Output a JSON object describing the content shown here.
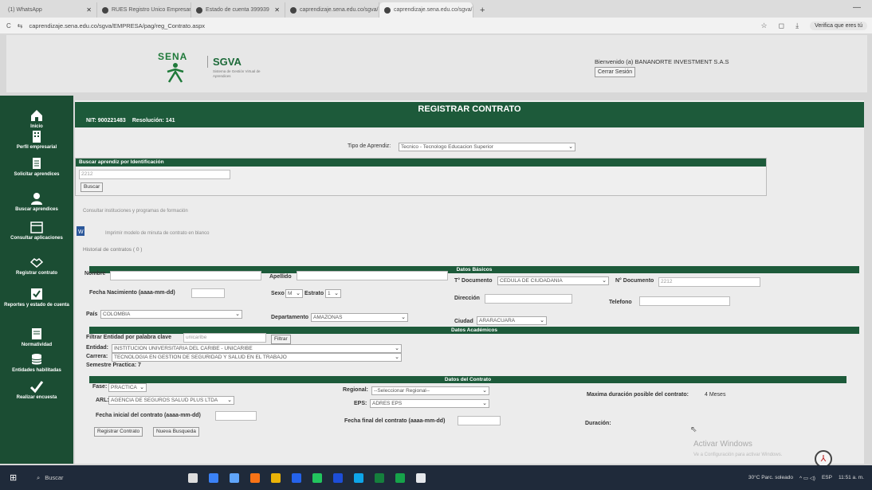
{
  "browser": {
    "tabs": [
      {
        "label": "(1) WhatsApp"
      },
      {
        "label": "RUES Registro Unico Empresar"
      },
      {
        "label": "Estado de cuenta 399939"
      },
      {
        "label": "caprendizaje.sena.edu.co/sgva/"
      },
      {
        "label": "caprendizaje.sena.edu.co/sgva/"
      }
    ],
    "new_tab": "+",
    "url": "caprendizaje.sena.edu.co/sgva/EMPRESA/pag/reg_Contrato.aspx",
    "verify_label": "Verifica que eres tú"
  },
  "header": {
    "sena_logo_text": "SENA",
    "sgva_title": "SGVA",
    "sgva_subtitle": "Sistema de Gestión Virtual de Aprendices",
    "welcome": "Bienvenido (a) BANANORTE INVESTMENT S.A.S",
    "logout_label": "Cerrar Sesión"
  },
  "sidebar": {
    "items": [
      {
        "label": "Inicio",
        "icon": "home-icon"
      },
      {
        "label": "Perfil empresarial",
        "icon": "building-icon"
      },
      {
        "label": "Solicitar aprendices",
        "icon": "document-icon"
      },
      {
        "label": "Buscar aprendices",
        "icon": "user-icon"
      },
      {
        "label": "Consultar aplicaciones",
        "icon": "calendar-icon"
      },
      {
        "label": "Registrar contrato",
        "icon": "handshake-icon"
      },
      {
        "label": "Reportes y estado de cuenta",
        "icon": "check-box-icon"
      },
      {
        "label": "Normatividad",
        "icon": "book-icon"
      },
      {
        "label": "Entidades habilitadas",
        "icon": "database-icon"
      },
      {
        "label": "Realizar encuesta",
        "icon": "checkmark-icon"
      }
    ]
  },
  "page": {
    "title": "REGISTRAR CONTRATO",
    "nit": "NIT: 900221483",
    "resolucion": "Resolución: 141",
    "tipo_aprendiz_label": "Tipo de Aprendiz:",
    "tipo_aprendiz_value": "Tecnico - Tecnologo Educacion Superior",
    "buscar_panel_title": "Buscar aprendiz por Identificación",
    "buscar_input_value": "2212",
    "buscar_button": "Buscar",
    "consultar_link": "Consultar instituciones y programas de formación",
    "imprimir_link": "Imprimir modelo de minuta de contrato en blanco",
    "historial": "Historial de contratos ( 0 )"
  },
  "datos_basicos": {
    "section_title": "Datos Básicos",
    "nombre_label": "Nombre",
    "apellido_label": "Apellido",
    "tdoc_label": "T° Documento",
    "tdoc_value": "CEDULA DE CIUDADANIA",
    "ndoc_label": "N° Documento",
    "ndoc_value": "2212",
    "fecha_nac_label": "Fecha Nacimiento (aaaa-mm-dd)",
    "sexo_label": "Sexo",
    "sexo_value": "M",
    "estrato_label": "Estrato",
    "estrato_value": "1",
    "direccion_label": "Dirección",
    "telefono_label": "Telefono",
    "pais_label": "País",
    "pais_value": "COLOMBIA",
    "departamento_label": "Departamento",
    "departamento_value": "AMAZONAS",
    "ciudad_label": "Ciudad",
    "ciudad_value": "ARARACUARA"
  },
  "datos_academicos": {
    "section_title": "Datos Académicos",
    "filtrar_label": "Filtrar Entidad por palabra clave",
    "filtrar_value": "unicaribe",
    "filtrar_button": "Filtrar",
    "entidad_label": "Entidad:",
    "entidad_value": "INSTITUCION UNIVERSITARIA DEL CARIBE - UNICARIBE",
    "carrera_label": "Carrera:",
    "carrera_value": "TECNOLOGIA EN GESTION DE SEGURIDAD Y SALUD EN EL TRABAJO",
    "semestre": "Semestre Practica: 7"
  },
  "datos_contrato": {
    "section_title": "Datos del Contrato",
    "fase_label": "Fase:",
    "fase_value": "PRACTICA",
    "regional_label": "Regional:",
    "regional_value": "--Seleccionar Regional--",
    "max_duracion_label": "Maxima duración posible del contrato:",
    "max_duracion_value": "4 Meses",
    "arl_label": "ARL:",
    "arl_value": "AGENCIA DE SEGUROS SALUD PLUS LTDA",
    "eps_label": "EPS:",
    "eps_value": "ADRES EPS",
    "fecha_inicial_label": "Fecha inicial del contrato (aaaa-mm-dd)",
    "fecha_final_label": "Fecha final del contrato (aaaa-mm-dd)",
    "duracion_label": "Duración:",
    "registrar_button": "Registrar Contrato",
    "nueva_busqueda_button": "Nueva Busqueda"
  },
  "watermark": {
    "line1": "Activar Windows",
    "line2": "Ve a Configuración para activar Windows."
  },
  "taskbar": {
    "search": "Buscar",
    "weather": "30°C Parc. soleado",
    "lang": "ESP",
    "time": "11:51 a. m."
  }
}
